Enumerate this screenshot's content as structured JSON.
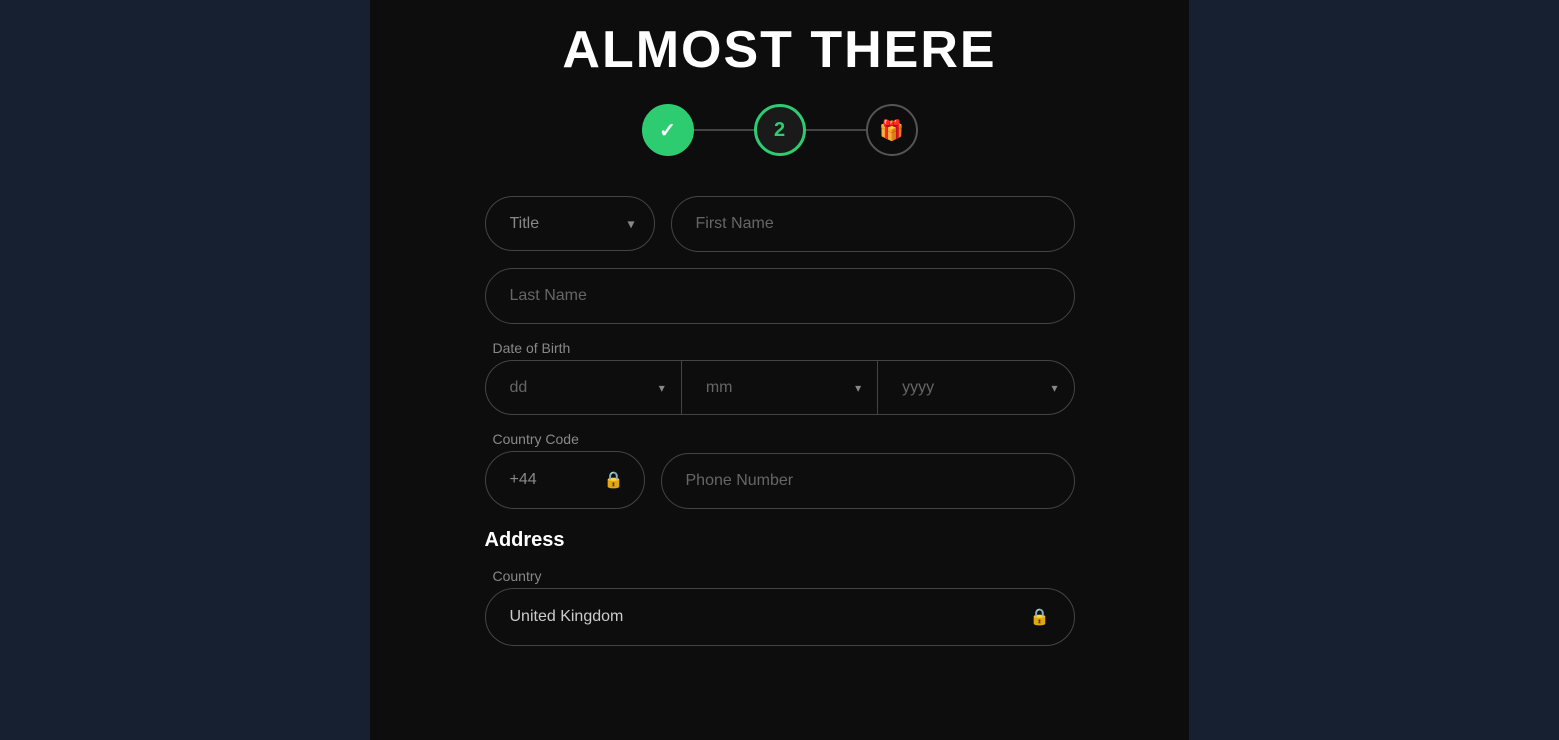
{
  "page": {
    "title": "ALMOST THERE",
    "background_left": "#162030",
    "background_center": "#0d0d0d"
  },
  "stepper": {
    "steps": [
      {
        "id": 1,
        "label": "✓",
        "state": "completed"
      },
      {
        "id": 2,
        "label": "2",
        "state": "active"
      },
      {
        "id": 3,
        "label": "🎁",
        "state": "inactive"
      }
    ]
  },
  "form": {
    "title_placeholder": "Title",
    "first_name_placeholder": "First Name",
    "last_name_placeholder": "Last Name",
    "dob_label": "Date of Birth",
    "dob_day_placeholder": "dd",
    "dob_month_placeholder": "mm",
    "dob_year_placeholder": "yyyy",
    "country_code_label": "Country Code",
    "country_code_value": "+44",
    "phone_number_placeholder": "Phone Number",
    "address_label": "Address",
    "country_field_label": "Country",
    "country_value": "United Kingdom"
  }
}
